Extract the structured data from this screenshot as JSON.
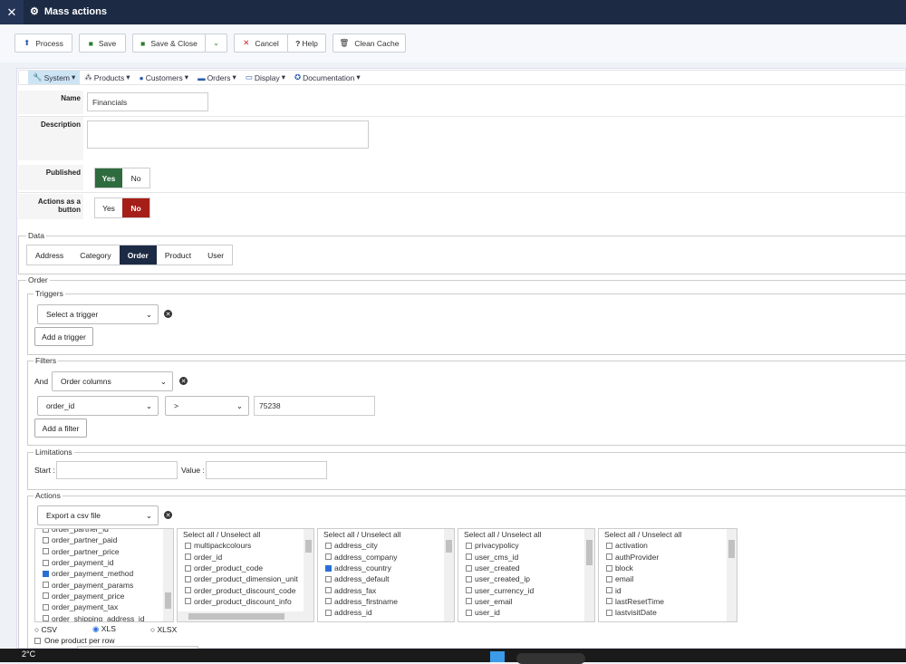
{
  "header": {
    "title": "Mass actions"
  },
  "toolbar": {
    "process": "Process",
    "save": "Save",
    "save_close": "Save & Close",
    "cancel": "Cancel",
    "help": "Help",
    "clean_cache": "Clean Cache"
  },
  "menu": [
    "System",
    "Products",
    "Customers",
    "Orders",
    "Display",
    "Documentation"
  ],
  "form": {
    "name_label": "Name",
    "name_value": "Financials",
    "description_label": "Description",
    "published_label": "Published",
    "actions_button_label": "Actions as a button",
    "yes": "Yes",
    "no": "No"
  },
  "data": {
    "legend": "Data",
    "tabs": [
      "Address",
      "Category",
      "Order",
      "Product",
      "User"
    ]
  },
  "order": {
    "legend": "Order",
    "triggers": {
      "legend": "Triggers",
      "select": "Select a trigger",
      "add": "Add a trigger"
    },
    "filters": {
      "legend": "Filters",
      "and": "And",
      "type": "Order columns",
      "column": "order_id",
      "operator": ">",
      "value": "75238",
      "add": "Add a filter"
    },
    "limitations": {
      "legend": "Limitations",
      "start": "Start :",
      "value": "Value :"
    },
    "actions": {
      "legend": "Actions",
      "select": "Export a csv file",
      "select_all": "Select all / Unselect all",
      "lists": [
        {
          "items": [
            {
              "l": "order_partner_id",
              "c": false
            },
            {
              "l": "order_partner_paid",
              "c": false
            },
            {
              "l": "order_partner_price",
              "c": false
            },
            {
              "l": "order_payment_id",
              "c": false
            },
            {
              "l": "order_payment_method",
              "c": true
            },
            {
              "l": "order_payment_params",
              "c": false
            },
            {
              "l": "order_payment_price",
              "c": false
            },
            {
              "l": "order_payment_tax",
              "c": false
            },
            {
              "l": "order_shipping_address_id",
              "c": false
            }
          ]
        },
        {
          "items": [
            {
              "l": "multipackcolours",
              "c": false
            },
            {
              "l": "order_id",
              "c": false
            },
            {
              "l": "order_product_code",
              "c": false
            },
            {
              "l": "order_product_dimension_unit",
              "c": false
            },
            {
              "l": "order_product_discount_code",
              "c": false
            },
            {
              "l": "order_product_discount_info",
              "c": false
            }
          ]
        },
        {
          "items": [
            {
              "l": "address_city",
              "c": false
            },
            {
              "l": "address_company",
              "c": false
            },
            {
              "l": "address_country",
              "c": true
            },
            {
              "l": "address_default",
              "c": false
            },
            {
              "l": "address_fax",
              "c": false
            },
            {
              "l": "address_firstname",
              "c": false
            },
            {
              "l": "address_id",
              "c": false
            }
          ]
        },
        {
          "items": [
            {
              "l": "privacypolicy",
              "c": false
            },
            {
              "l": "user_cms_id",
              "c": false
            },
            {
              "l": "user_created",
              "c": false
            },
            {
              "l": "user_created_ip",
              "c": false
            },
            {
              "l": "user_currency_id",
              "c": false
            },
            {
              "l": "user_email",
              "c": false
            },
            {
              "l": "user_id",
              "c": false
            }
          ]
        },
        {
          "items": [
            {
              "l": "activation",
              "c": false
            },
            {
              "l": "authProvider",
              "c": false
            },
            {
              "l": "block",
              "c": false
            },
            {
              "l": "email",
              "c": false
            },
            {
              "l": "id",
              "c": false
            },
            {
              "l": "lastResetTime",
              "c": false
            },
            {
              "l": "lastvisitDate",
              "c": false
            }
          ]
        }
      ],
      "formats": [
        "CSV",
        "XLS",
        "XLSX"
      ],
      "selected_format": "XLS",
      "one_per_row": "One product per row"
    }
  },
  "taskbar": {
    "weather": "2°C"
  }
}
